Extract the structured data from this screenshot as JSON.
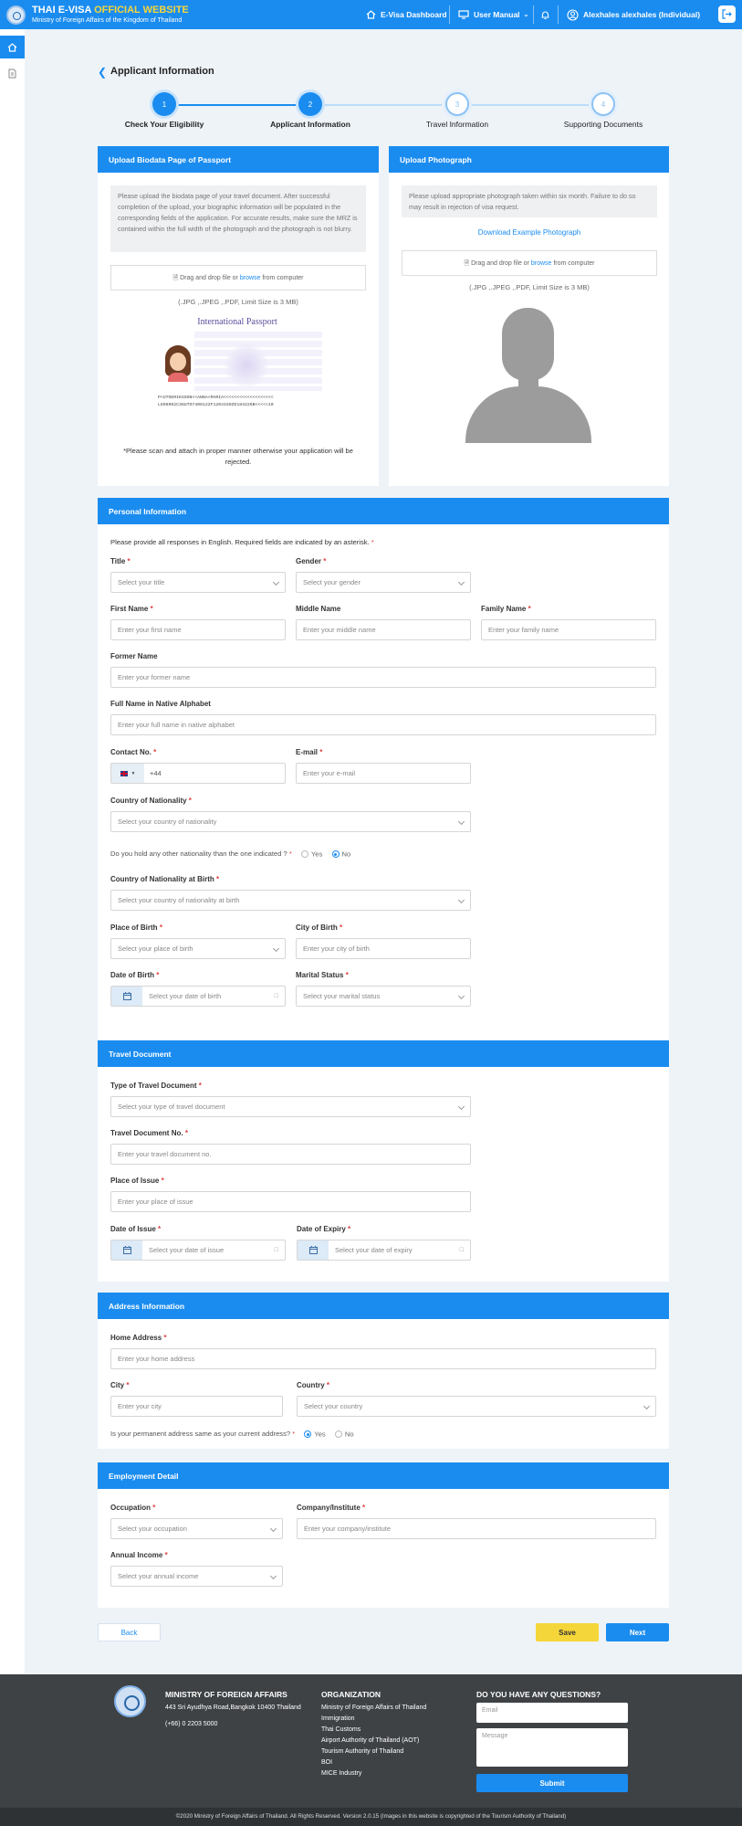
{
  "header": {
    "brand_part1": "THAI E-VISA",
    "brand_part2": "OFFICIAL WEBSITE",
    "subtitle": "Ministry of Foreign Affairs of the Kingdom of Thailand",
    "nav_dashboard": "E-Visa Dashboard",
    "nav_manual": "User Manual",
    "user": "Alexhales alexhales (Individual)",
    "accent": "#1a8cf0",
    "accent_yellow": "#f5d63a"
  },
  "page": {
    "title": "Applicant Information"
  },
  "steps": [
    {
      "num": "1",
      "label": "Check Your Eligibility"
    },
    {
      "num": "2",
      "label": "Applicant Information"
    },
    {
      "num": "3",
      "label": "Travel Information"
    },
    {
      "num": "4",
      "label": "Supporting Documents"
    }
  ],
  "passport": {
    "header": "Upload Biodata Page of Passport",
    "note": "Please upload the biodata page of your travel document. After successful completion of the upload, your biographic information will be populated in the corresponding fields of the application. For accurate results, make sure the MRZ is contained within the full width of the photograph and the photograph is not blurry.",
    "drop_prefix": "Drag and drop file or ",
    "drop_link": "browse",
    "drop_suffix": " from computer",
    "formats": "(.JPG ,.JPEG ,.PDF, Limit Size is 3 MB)",
    "sample_title": "International Passport",
    "mrz1": "P<UTOERIKSSON<<ANNA<MARIA<<<<<<<<<<<<<<<<<<<",
    "mrz2": "L898902C36UTO7408122F1204159ZE184226B<<<<<10",
    "warning": "*Please scan and attach in proper manner otherwise your application will be rejected."
  },
  "photo": {
    "header": "Upload Photograph",
    "note": "Please upload appropriate photograph taken within six month. Failure to do so may result in rejection of visa request.",
    "download_link": "Download Example Photograph",
    "drop_prefix": "Drag and drop file or ",
    "drop_link": "browse",
    "drop_suffix": " from computer",
    "formats": "(.JPG ,.JPEG ,.PDF, Limit Size is 3 MB)"
  },
  "personal": {
    "header": "Personal Information",
    "intro": "Please provide all responses in English. Required fields are indicated by an asterisk.",
    "title_label": "Title",
    "title_ph": "Select your title",
    "gender_label": "Gender",
    "gender_ph": "Select your gender",
    "first_label": "First Name",
    "first_ph": "Enter your first name",
    "middle_label": "Middle Name",
    "middle_ph": "Enter your middle name",
    "family_label": "Family Name",
    "family_ph": "Enter your family name",
    "former_label": "Former Name",
    "former_ph": "Enter your former name",
    "native_label": "Full Name in Native Alphabet",
    "native_ph": "Enter your full name in native alphabet",
    "contact_label": "Contact No.",
    "contact_code": "+44",
    "email_label": "E-mail",
    "email_ph": "Enter your e-mail",
    "nationality_label": "Country of Nationality",
    "nationality_ph": "Select your country of nationality",
    "other_nat_q": "Do you hold any other nationality than the one indicated ?",
    "yes": "Yes",
    "no": "No",
    "nat_birth_label": "Country of Nationality at Birth",
    "nat_birth_ph": "Select your country of nationality at birth",
    "pob_label": "Place of Birth",
    "pob_ph": "Select your place of birth",
    "cob_label": "City of Birth",
    "cob_ph": "Enter your city of birth",
    "dob_label": "Date of Birth",
    "dob_ph": "Select your date of birth",
    "marital_label": "Marital Status",
    "marital_ph": "Select your marital status"
  },
  "travel": {
    "header": "Travel Document",
    "type_label": "Type of Travel Document",
    "type_ph": "Select your type of travel document",
    "no_label": "Travel Document No.",
    "no_ph": "Enter your travel document no.",
    "poi_label": "Place of Issue",
    "poi_ph": "Enter your place of issue",
    "doi_label": "Date of Issue",
    "doi_ph": "Select your date of issue",
    "doe_label": "Date of Expiry",
    "doe_ph": "Select your date of expiry"
  },
  "address": {
    "header": "Address Information",
    "home_label": "Home Address",
    "home_ph": "Enter your home address",
    "city_label": "City",
    "city_ph": "Enter your city",
    "country_label": "Country",
    "country_ph": "Select your country",
    "same_q": "Is your permanent address same as your current address?",
    "yes": "Yes",
    "no": "No"
  },
  "employment": {
    "header": "Employment Detail",
    "occ_label": "Occupation",
    "occ_ph": "Select your occupation",
    "company_label": "Company/Institute",
    "company_ph": "Enter your company/institute",
    "income_label": "Annual Income",
    "income_ph": "Select your annual income"
  },
  "actions": {
    "back": "Back",
    "save": "Save",
    "next": "Next"
  },
  "footer": {
    "ministry": "MINISTRY OF FOREIGN AFFAIRS",
    "address": "443 Sri Ayudhya Road,Bangkok 10400 Thailand",
    "phone": "(+66) 0 2203 5000",
    "org_head": "ORGANIZATION",
    "orgs": [
      "Ministry of Foreign Affairs of Thailand",
      "Immigration",
      "Thai Customs",
      "Airport Authority of Thailand (AOT)",
      "Tourism Authority of Thailand",
      "BOI",
      "MICE Industry"
    ],
    "q_head": "DO YOU HAVE ANY QUESTIONS?",
    "email_ph": "Email",
    "message_ph": "Message",
    "submit": "Submit",
    "copyright": "©2020 Ministry of Foreign Affairs of Thailand. All Rights Reserved. Version 2.0.15 (Images in this website is copyrighted of the Tourism Authority of Thailand)"
  }
}
